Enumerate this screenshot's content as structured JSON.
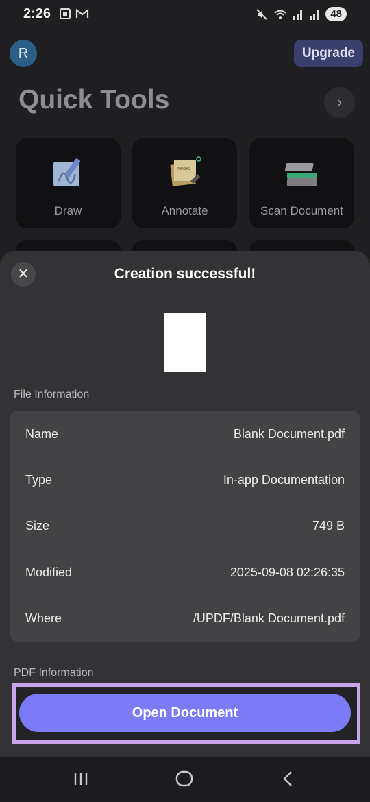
{
  "status_bar": {
    "time": "2:26",
    "left_icons": [
      "screenshot-icon",
      "gmail-icon"
    ],
    "right_icons": [
      "mute-icon",
      "wifi-icon",
      "signal-icon",
      "signal-icon"
    ],
    "battery": "48"
  },
  "header": {
    "avatar_letter": "R",
    "upgrade_label": "Upgrade",
    "title": "Quick Tools",
    "next_icon": "chevron-right-icon"
  },
  "tools": [
    {
      "label": "Draw",
      "icon": "draw-icon"
    },
    {
      "label": "Annotate",
      "icon": "annotate-icon"
    },
    {
      "label": "Scan Document",
      "icon": "scanner-icon"
    }
  ],
  "annotate_note_text": "Notes",
  "sheet": {
    "title": "Creation successful!",
    "close_icon": "close-icon",
    "file_info_label": "File Information",
    "file_info": [
      {
        "key": "Name",
        "value": "Blank Document.pdf"
      },
      {
        "key": "Type",
        "value": "In-app Documentation"
      },
      {
        "key": "Size",
        "value": "749 B"
      },
      {
        "key": "Modified",
        "value": "2025-09-08 02:26:35"
      },
      {
        "key": "Where",
        "value": "/UPDF/Blank Document.pdf"
      }
    ],
    "pdf_info_label": "PDF Information",
    "open_button": "Open Document"
  },
  "nav": {
    "recent_icon": "recent-apps-icon",
    "home_icon": "home-icon",
    "back_icon": "back-icon"
  },
  "colors": {
    "accent": "#7b7cf5",
    "highlight": "#c9a6ec",
    "sheet_bg": "#333335",
    "card_bg": "#434346"
  }
}
